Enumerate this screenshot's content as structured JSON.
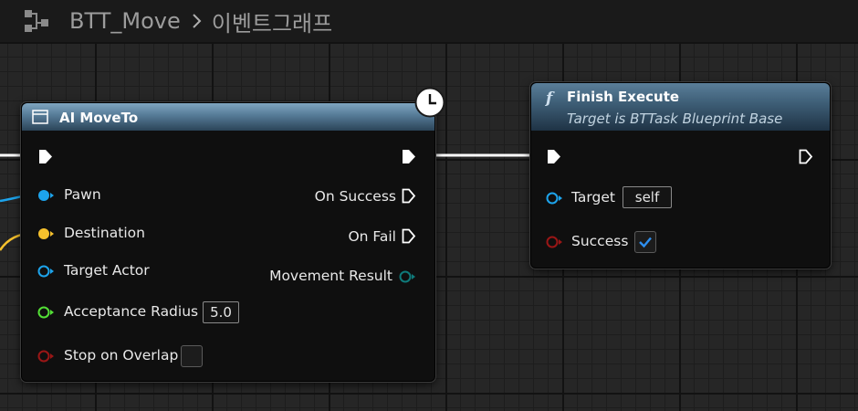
{
  "breadcrumb": {
    "blueprint_name": "BTT_Move",
    "graph_name": "이벤트그래프"
  },
  "icons": {
    "graph": "node-graph-icon",
    "separator": "chevron-right-icon",
    "latent": "clock-icon",
    "function": "function-icon",
    "node": "node-icon",
    "checkmark": "checkmark-icon"
  },
  "ai_move_to": {
    "title": "AI MoveTo",
    "inputs": [
      {
        "label": "Pawn",
        "color": "#1da4ec"
      },
      {
        "label": "Destination",
        "color": "#f6c12d"
      },
      {
        "label": "Target Actor",
        "color": "#1da4ec"
      },
      {
        "label": "Acceptance Radius",
        "color": "#53e036",
        "value": "5.0"
      },
      {
        "label": "Stop on Overlap",
        "color": "#9a1616"
      }
    ],
    "outputs": [
      {
        "label": "On Success"
      },
      {
        "label": "On Fail"
      },
      {
        "label": "Movement Result",
        "color": "#0f7a7a"
      }
    ]
  },
  "finish_execute": {
    "title": "Finish Execute",
    "subtitle": "Target is BTTask Blueprint Base",
    "inputs": [
      {
        "label": "Target",
        "color": "#1da4ec",
        "value": "self"
      },
      {
        "label": "Success",
        "color": "#9a1616",
        "checked": true
      }
    ]
  },
  "colors": {
    "exec_wire": "#ffffff",
    "object_wire": "#1da4ec",
    "vector_wire": "#f6c12d",
    "header_blue": "#557a96"
  }
}
